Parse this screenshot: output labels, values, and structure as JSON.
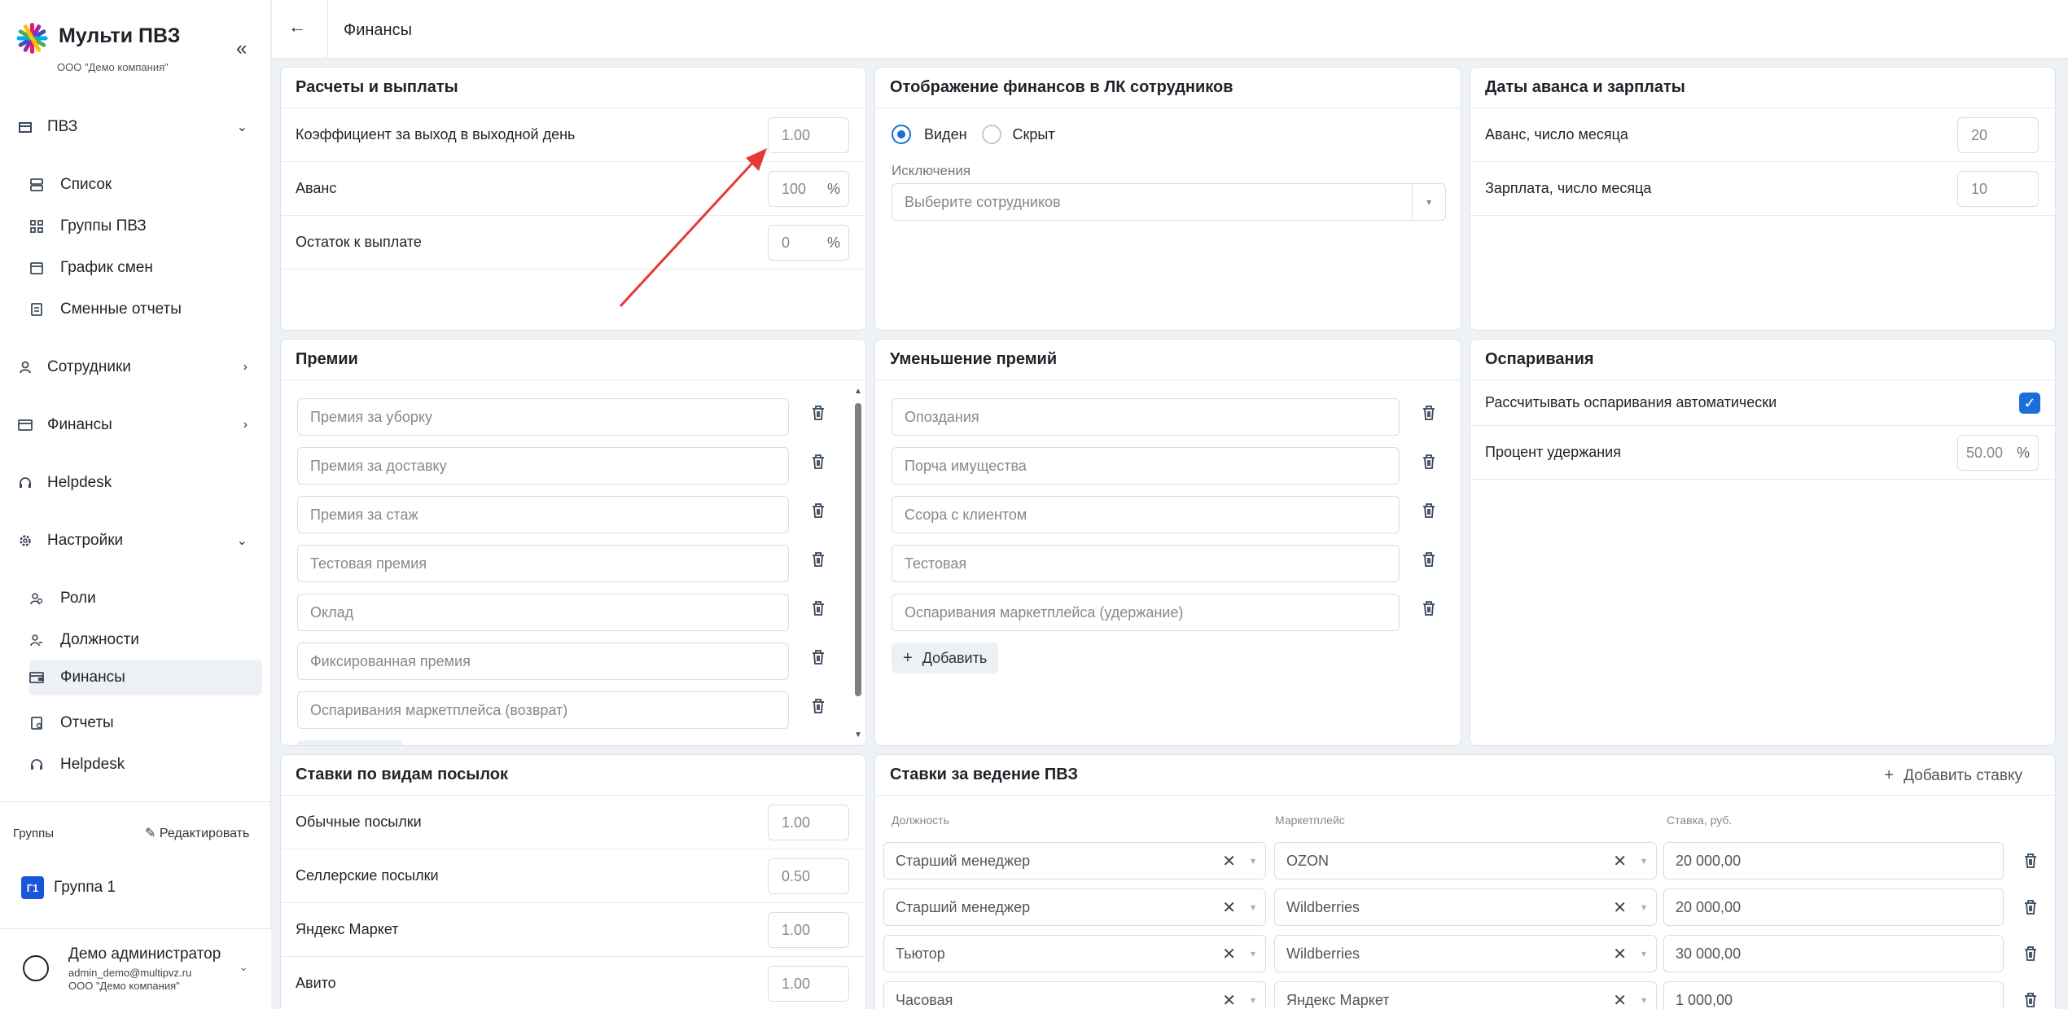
{
  "app": {
    "title": "Мульти ПВЗ",
    "org": "ООО \"Демо компания\""
  },
  "nav": {
    "pvz": "ПВЗ",
    "pvz_items": [
      "Список",
      "Группы ПВЗ",
      "График смен",
      "Сменные отчеты"
    ],
    "employees": "Сотрудники",
    "finance": "Финансы",
    "helpdesk": "Helpdesk",
    "settings": "Настройки",
    "settings_items": [
      "Роли",
      "Должности",
      "Финансы",
      "Отчеты",
      "Helpdesk"
    ]
  },
  "groups": {
    "label": "Группы",
    "edit": "Редактировать",
    "items": [
      {
        "badge": "Г1",
        "name": "Группа 1"
      }
    ]
  },
  "user": {
    "name": "Демо администратор",
    "email": "admin_demo@multipvz.ru",
    "org": "ООО \"Демо компания\""
  },
  "page": {
    "title": "Финансы"
  },
  "payments": {
    "title": "Расчеты и выплаты",
    "rows": [
      {
        "label": "Коэффициент за выход в выходной день",
        "value": "1.00",
        "unit": ""
      },
      {
        "label": "Аванс",
        "value": "100",
        "unit": "%"
      },
      {
        "label": "Остаток к выплате",
        "value": "0",
        "unit": "%"
      }
    ]
  },
  "display": {
    "title": "Отображение финансов в ЛК сотрудников",
    "option_visible": "Виден",
    "option_hidden": "Скрыт",
    "selected": "Виден",
    "exceptions_label": "Исключения",
    "exceptions_placeholder": "Выберите сотрудников"
  },
  "dates": {
    "title": "Даты аванса и зарплаты",
    "rows": [
      {
        "label": "Аванс, число месяца",
        "value": "20"
      },
      {
        "label": "Зарплата, число месяца",
        "value": "10"
      }
    ]
  },
  "bonuses": {
    "title": "Премии",
    "items": [
      "Премия за уборку",
      "Премия за доставку",
      "Премия за стаж",
      "Тестовая премия",
      "Оклад",
      "Фиксированная премия",
      "Оспаривания маркетплейса (возврат)"
    ]
  },
  "deductions": {
    "title": "Уменьшение премий",
    "items": [
      "Опоздания",
      "Порча имущества",
      "Ссора с клиентом",
      "Тестовая",
      "Оспаривания маркетплейса (удержание)"
    ],
    "add_label": "Добавить"
  },
  "disputes": {
    "title": "Оспаривания",
    "auto_label": "Рассчитывать оспаривания автоматически",
    "auto_checked": true,
    "percent_label": "Процент удержания",
    "percent_value": "50.00",
    "percent_unit": "%"
  },
  "parcel_rates": {
    "title": "Ставки по видам посылок",
    "rows": [
      {
        "label": "Обычные посылки",
        "value": "1.00"
      },
      {
        "label": "Селлерские посылки",
        "value": "0.50"
      },
      {
        "label": "Яндекс Маркет",
        "value": "1.00"
      },
      {
        "label": "Авито",
        "value": "1.00"
      }
    ]
  },
  "pvz_rates": {
    "title": "Ставки за ведение ПВЗ",
    "add_label": "Добавить ставку",
    "columns": [
      "Должность",
      "Маркетплейс",
      "Ставка, руб."
    ],
    "rows": [
      {
        "position": "Старший менеджер",
        "marketplace": "OZON",
        "rate": "20 000,00"
      },
      {
        "position": "Старший менеджер",
        "marketplace": "Wildberries",
        "rate": "20 000,00"
      },
      {
        "position": "Тьютор",
        "marketplace": "Wildberries",
        "rate": "30 000,00"
      },
      {
        "position": "Часовая",
        "marketplace": "Яндекс Маркет",
        "rate": "1 000,00"
      }
    ]
  },
  "colors": {
    "accent": "#1a6fd8",
    "annotation_arrow": "#e53935",
    "group_badge": "#1a56db"
  }
}
